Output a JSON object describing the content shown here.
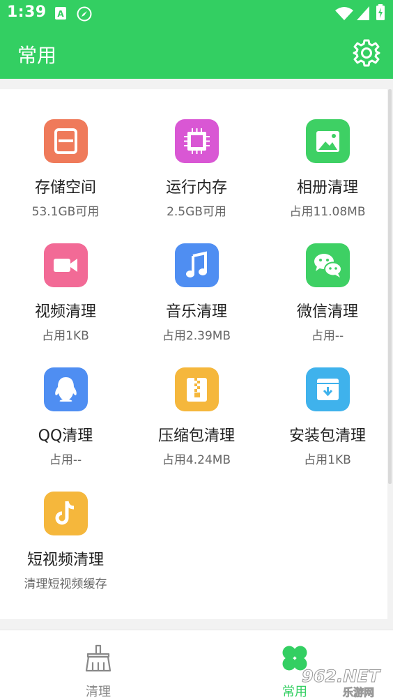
{
  "status_bar": {
    "time": "1:39"
  },
  "app_bar": {
    "title": "常用"
  },
  "tiles": [
    {
      "name": "存储空间",
      "sub": "53.1GB可用",
      "color": "#ef7a5a",
      "icon": "save-icon"
    },
    {
      "name": "运行内存",
      "sub": "2.5GB可用",
      "color": "#d957d4",
      "icon": "chip-icon"
    },
    {
      "name": "相册清理",
      "sub": "占用11.08MB",
      "color": "#3ed064",
      "icon": "image-icon"
    },
    {
      "name": "视频清理",
      "sub": "占用1KB",
      "color": "#f26a96",
      "icon": "video-camera-icon"
    },
    {
      "name": "音乐清理",
      "sub": "占用2.39MB",
      "color": "#4f8ef2",
      "icon": "music-note-icon"
    },
    {
      "name": "微信清理",
      "sub": "占用--",
      "color": "#3ed064",
      "icon": "wechat-icon"
    },
    {
      "name": "QQ清理",
      "sub": "占用--",
      "color": "#4f8ef2",
      "icon": "qq-penguin-icon"
    },
    {
      "name": "压缩包清理",
      "sub": "占用4.24MB",
      "color": "#f5b73c",
      "icon": "zip-icon"
    },
    {
      "name": "安装包清理",
      "sub": "占用1KB",
      "color": "#3fb2ec",
      "icon": "download-box-icon"
    },
    {
      "name": "短视频清理",
      "sub": "清理短视频缓存",
      "color": "#f5b73c",
      "icon": "tiktok-icon"
    }
  ],
  "bottom_nav": [
    {
      "label": "清理",
      "active": false,
      "icon": "broom-icon",
      "color": "#888888"
    },
    {
      "label": "常用",
      "active": true,
      "icon": "clover-icon",
      "color": "#33cf62"
    }
  ],
  "watermark": {
    "big": "962.NET",
    "small": "乐游网"
  },
  "colors": {
    "brand": "#33cf62"
  }
}
